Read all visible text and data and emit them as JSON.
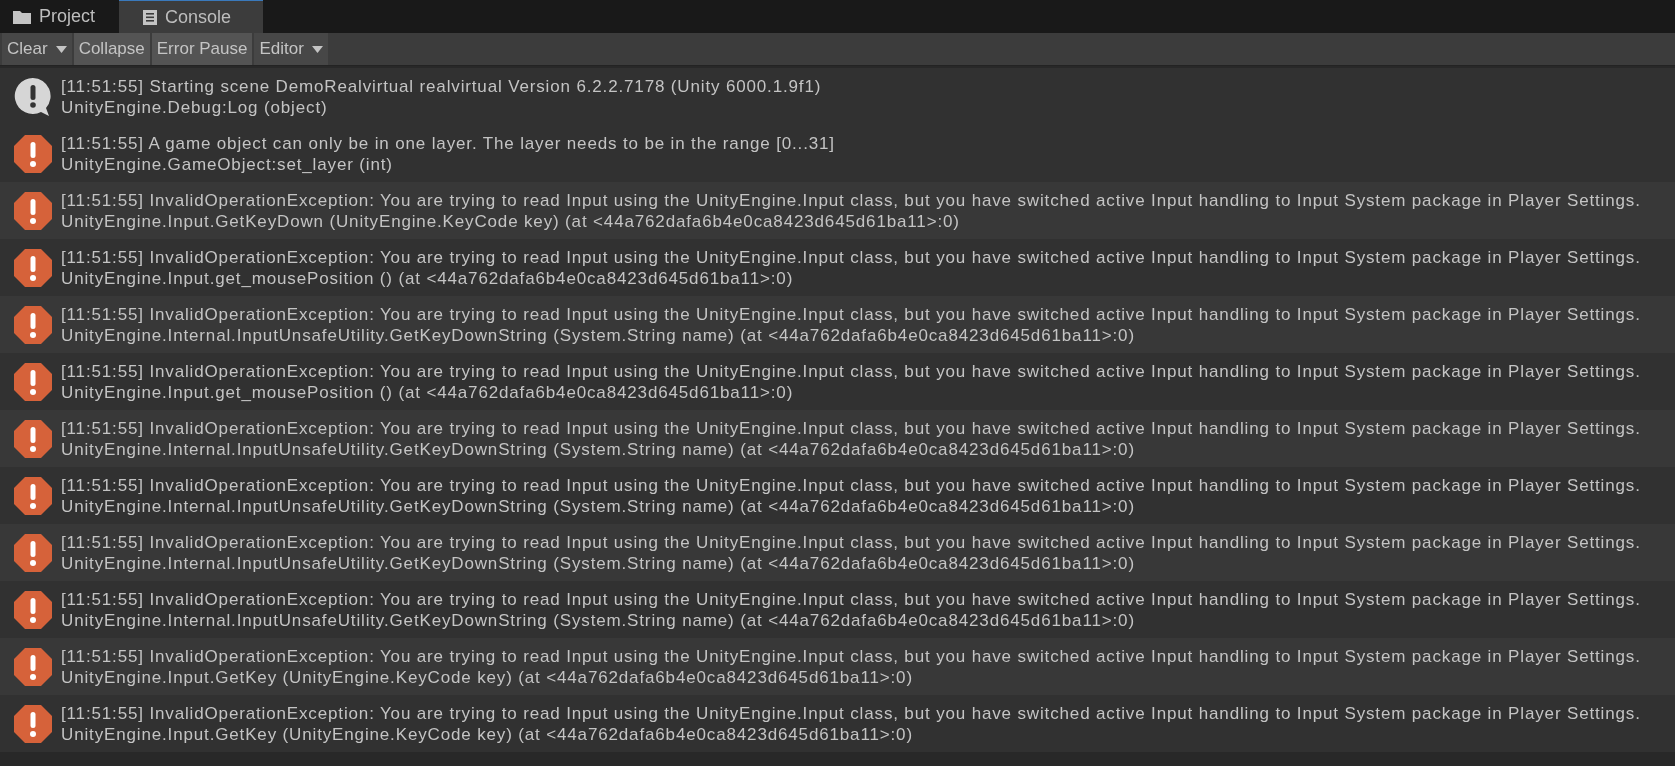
{
  "tabs": [
    {
      "label": "Project",
      "kind": "folder",
      "selected": false
    },
    {
      "label": "Console",
      "kind": "list",
      "selected": true
    }
  ],
  "toolbar": {
    "buttons": [
      {
        "label": "Clear",
        "dropdown": true
      },
      {
        "label": "Collapse",
        "dropdown": false
      },
      {
        "label": "Error Pause",
        "dropdown": false
      },
      {
        "label": "Editor",
        "dropdown": true
      }
    ]
  },
  "log_entries": [
    {
      "kind": "info",
      "message": "[11:51:55] Starting scene DemoRealvirtual realvirtual Version 6.2.2.7178 (Unity 6000.1.9f1)",
      "source": "UnityEngine.Debug:Log (object)"
    },
    {
      "kind": "error",
      "message": "[11:51:55] A game object can only be in one layer. The layer needs to be in the range [0...31]",
      "source": "UnityEngine.GameObject:set_layer (int)"
    },
    {
      "kind": "error",
      "message": "[11:51:55] InvalidOperationException: You are trying to read Input using the UnityEngine.Input class, but you have switched active Input handling to Input System package in Player Settings.",
      "source": "UnityEngine.Input.GetKeyDown (UnityEngine.KeyCode key) (at <44a762dafa6b4e0ca8423d645d61ba11>:0)"
    },
    {
      "kind": "error",
      "message": "[11:51:55] InvalidOperationException: You are trying to read Input using the UnityEngine.Input class, but you have switched active Input handling to Input System package in Player Settings.",
      "source": "UnityEngine.Input.get_mousePosition () (at <44a762dafa6b4e0ca8423d645d61ba11>:0)"
    },
    {
      "kind": "error",
      "message": "[11:51:55] InvalidOperationException: You are trying to read Input using the UnityEngine.Input class, but you have switched active Input handling to Input System package in Player Settings.",
      "source": "UnityEngine.Internal.InputUnsafeUtility.GetKeyDownString (System.String name) (at <44a762dafa6b4e0ca8423d645d61ba11>:0)"
    },
    {
      "kind": "error",
      "message": "[11:51:55] InvalidOperationException: You are trying to read Input using the UnityEngine.Input class, but you have switched active Input handling to Input System package in Player Settings.",
      "source": "UnityEngine.Input.get_mousePosition () (at <44a762dafa6b4e0ca8423d645d61ba11>:0)"
    },
    {
      "kind": "error",
      "message": "[11:51:55] InvalidOperationException: You are trying to read Input using the UnityEngine.Input class, but you have switched active Input handling to Input System package in Player Settings.",
      "source": "UnityEngine.Internal.InputUnsafeUtility.GetKeyDownString (System.String name) (at <44a762dafa6b4e0ca8423d645d61ba11>:0)"
    },
    {
      "kind": "error",
      "message": "[11:51:55] InvalidOperationException: You are trying to read Input using the UnityEngine.Input class, but you have switched active Input handling to Input System package in Player Settings.",
      "source": "UnityEngine.Internal.InputUnsafeUtility.GetKeyDownString (System.String name) (at <44a762dafa6b4e0ca8423d645d61ba11>:0)"
    },
    {
      "kind": "error",
      "message": "[11:51:55] InvalidOperationException: You are trying to read Input using the UnityEngine.Input class, but you have switched active Input handling to Input System package in Player Settings.",
      "source": "UnityEngine.Internal.InputUnsafeUtility.GetKeyDownString (System.String name) (at <44a762dafa6b4e0ca8423d645d61ba11>:0)"
    },
    {
      "kind": "error",
      "message": "[11:51:55] InvalidOperationException: You are trying to read Input using the UnityEngine.Input class, but you have switched active Input handling to Input System package in Player Settings.",
      "source": "UnityEngine.Internal.InputUnsafeUtility.GetKeyDownString (System.String name) (at <44a762dafa6b4e0ca8423d645d61ba11>:0)"
    },
    {
      "kind": "error",
      "message": "[11:51:55] InvalidOperationException: You are trying to read Input using the UnityEngine.Input class, but you have switched active Input handling to Input System package in Player Settings.",
      "source": "UnityEngine.Input.GetKey (UnityEngine.KeyCode key) (at <44a762dafa6b4e0ca8423d645d61ba11>:0)"
    },
    {
      "kind": "error",
      "message": "[11:51:55] InvalidOperationException: You are trying to read Input using the UnityEngine.Input class, but you have switched active Input handling to Input System package in Player Settings.",
      "source": "UnityEngine.Input.GetKey (UnityEngine.KeyCode key) (at <44a762dafa6b4e0ca8423d645d61ba11>:0)"
    }
  ]
}
